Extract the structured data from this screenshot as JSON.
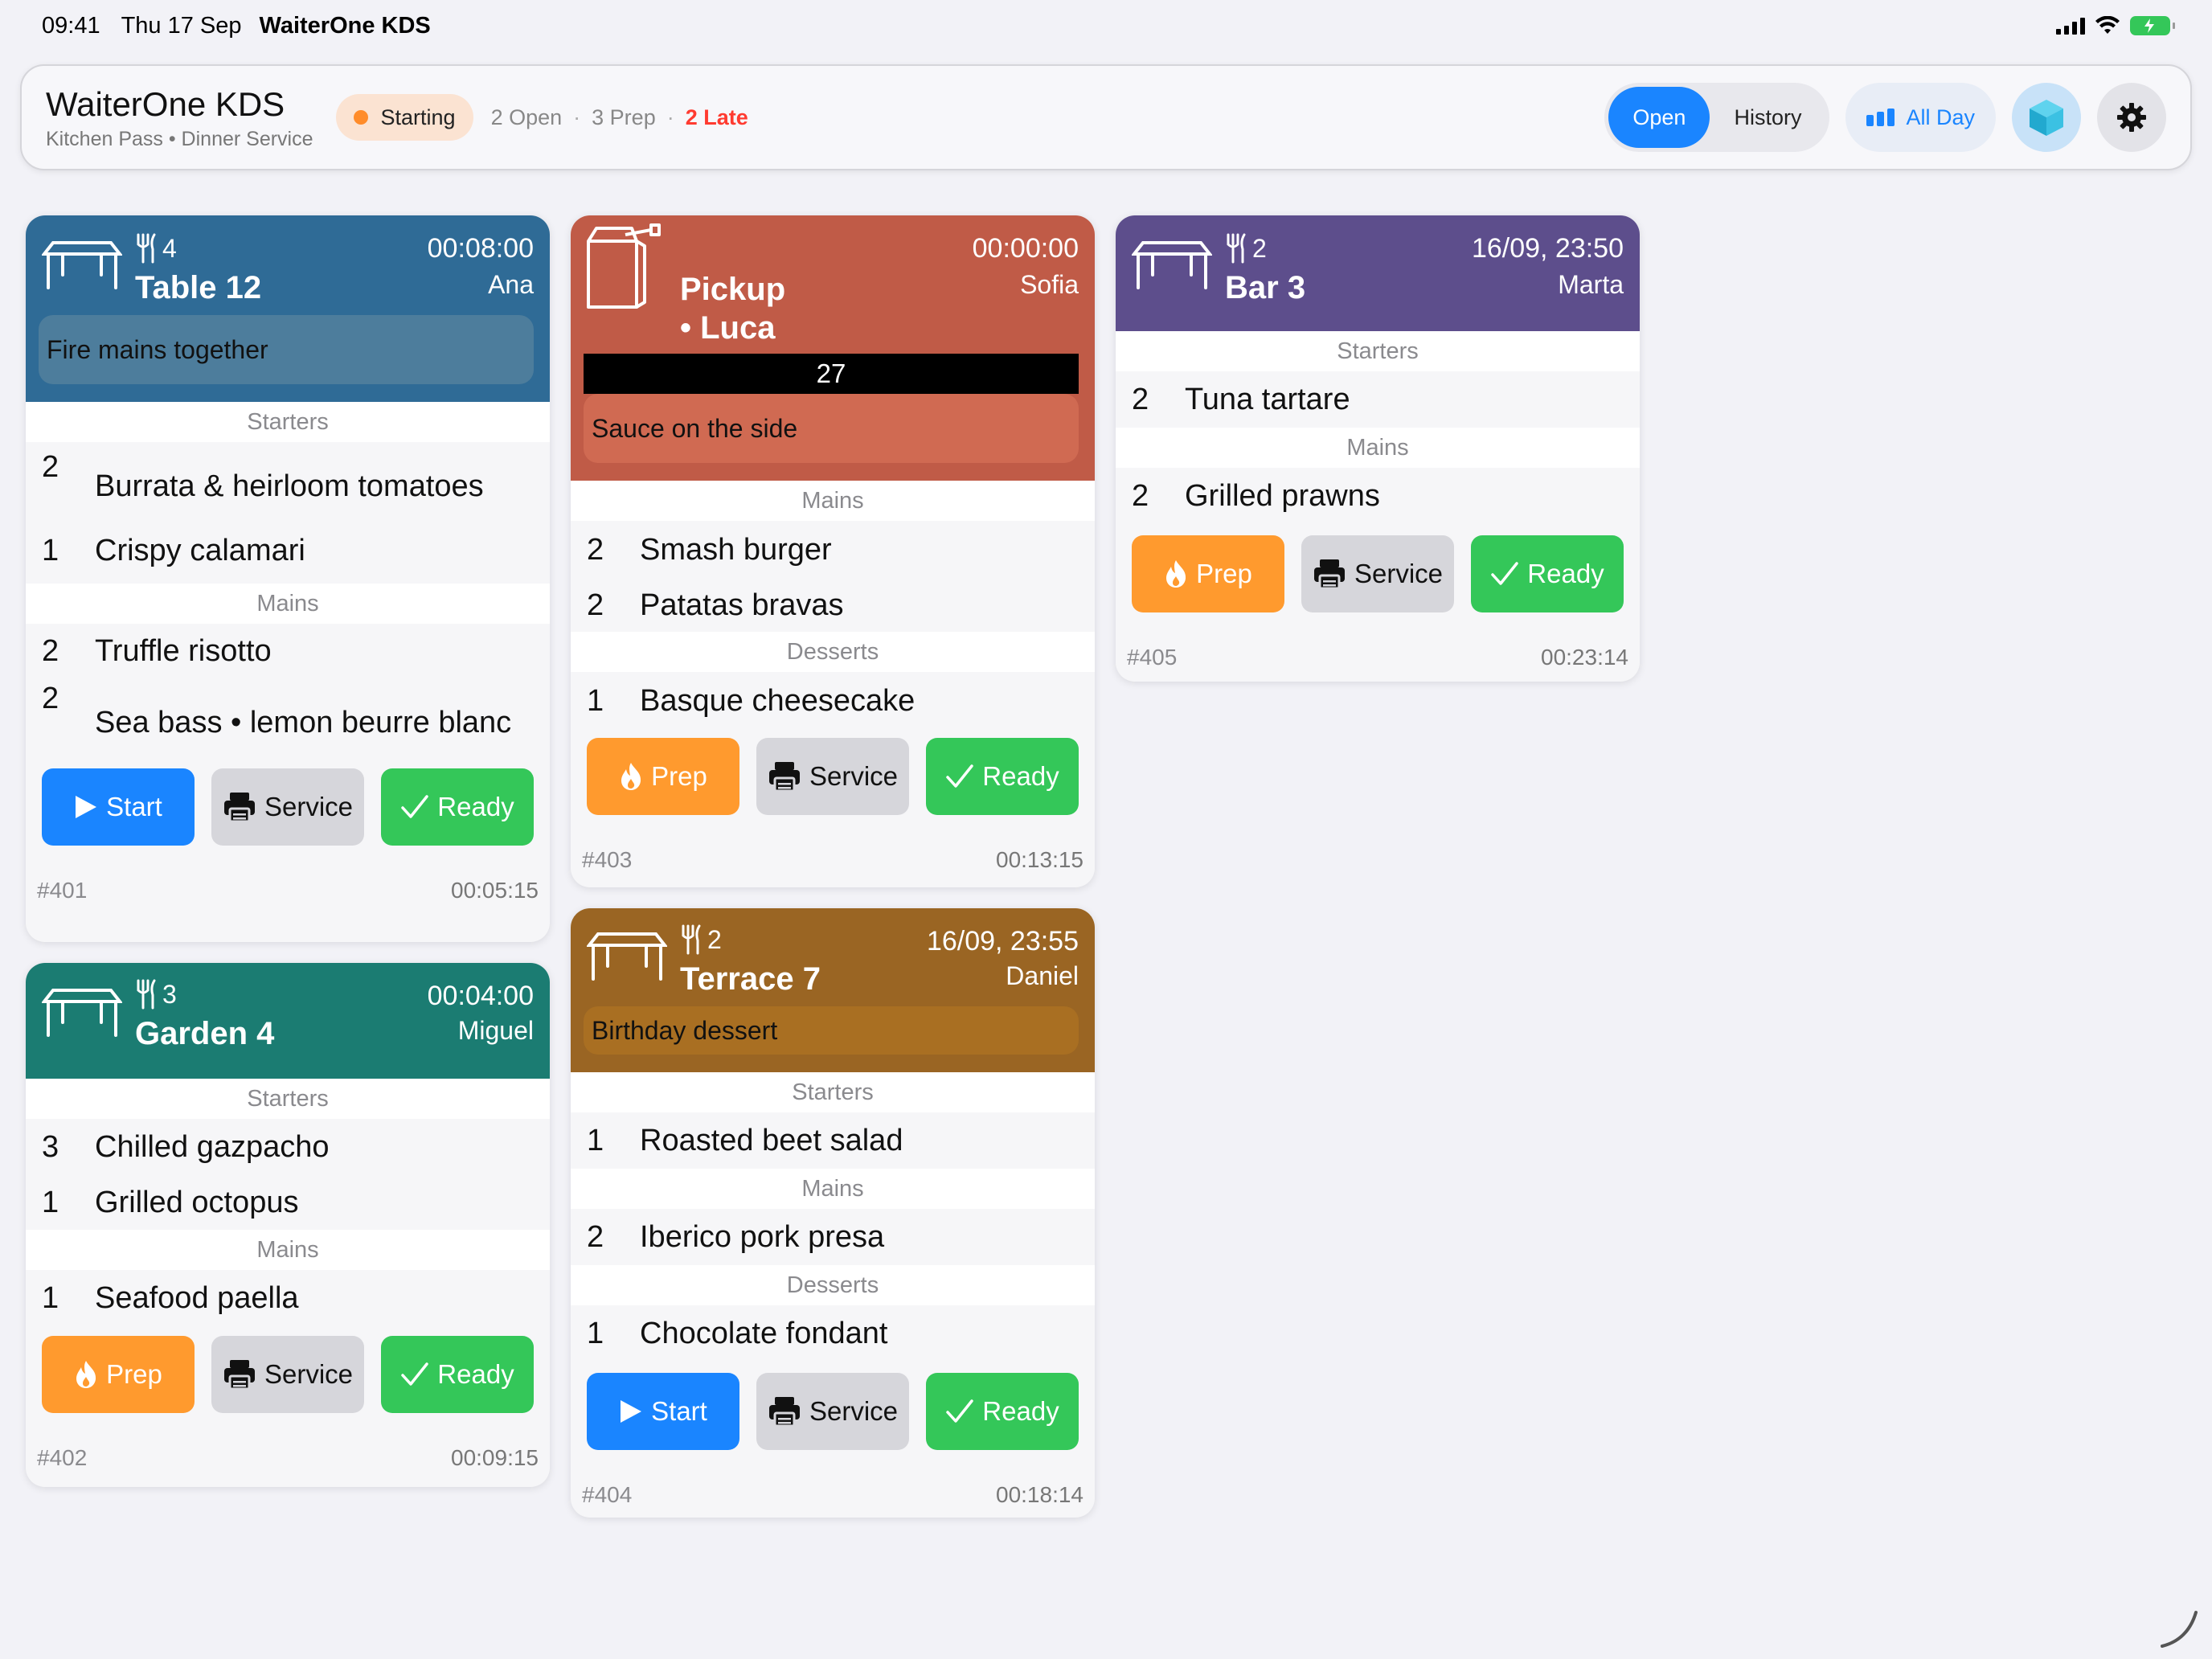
{
  "status_bar": {
    "time": "09:41",
    "date": "Thu 17 Sep",
    "app": "WaiterOne KDS"
  },
  "header": {
    "title": "WaiterOne KDS",
    "subtitle": "Kitchen Pass • Dinner Service",
    "status": "Starting",
    "open_count": "2 Open",
    "prep_count": "3 Prep",
    "late_count": "2 Late",
    "sep": "·",
    "tab_open": "Open",
    "tab_history": "History",
    "all_day": "All Day",
    "colors": {
      "accent": "#1a85ff",
      "late": "#ff3b30",
      "status_dot": "#ff8c2a"
    }
  },
  "tickets": [
    {
      "name": "Table 12",
      "covers": "4",
      "timer": "00:08:00",
      "server": "Ana",
      "note": "Fire mains together",
      "color": "#2f6b96",
      "note_color": "#4d7d9c",
      "sections": [
        {
          "label": "Starters",
          "items": [
            {
              "qty": "2",
              "name": "Burrata & heirloom tomatoes"
            },
            {
              "qty": "1",
              "name": "Crispy calamari"
            }
          ]
        },
        {
          "label": "Mains",
          "items": [
            {
              "qty": "2",
              "name": "Truffle risotto"
            },
            {
              "qty": "2",
              "name": "Sea bass • lemon beurre blanc"
            }
          ]
        }
      ],
      "primary": "Start",
      "service": "Service",
      "ready": "Ready",
      "number": "#401",
      "elapsed": "00:05:15"
    },
    {
      "name": "Garden 4",
      "covers": "3",
      "timer": "00:04:00",
      "server": "Miguel",
      "color": "#1b7c72",
      "sections": [
        {
          "label": "Starters",
          "items": [
            {
              "qty": "3",
              "name": "Chilled gazpacho"
            },
            {
              "qty": "1",
              "name": "Grilled octopus"
            }
          ]
        },
        {
          "label": "Mains",
          "items": [
            {
              "qty": "1",
              "name": "Seafood paella"
            }
          ]
        }
      ],
      "primary": "Prep",
      "service": "Service",
      "ready": "Ready",
      "number": "#402",
      "elapsed": "00:09:15"
    },
    {
      "name": "Pickup",
      "name2": "• Luca",
      "timer": "00:00:00",
      "server": "Sofia",
      "pickup_number": "27",
      "note": "Sauce on the side",
      "color": "#c05b47",
      "note_color": "#d06a52",
      "sections": [
        {
          "label": "Mains",
          "items": [
            {
              "qty": "2",
              "name": "Smash burger"
            },
            {
              "qty": "2",
              "name": "Patatas bravas"
            }
          ]
        },
        {
          "label": "Desserts",
          "items": [
            {
              "qty": "1",
              "name": "Basque cheesecake"
            }
          ]
        }
      ],
      "primary": "Prep",
      "service": "Service",
      "ready": "Ready",
      "number": "#403",
      "elapsed": "00:13:15"
    },
    {
      "name": "Terrace 7",
      "covers": "2",
      "timer": "16/09, 23:55",
      "server": "Daniel",
      "note": "Birthday dessert",
      "color": "#9a6523",
      "note_color": "#a96f22",
      "sections": [
        {
          "label": "Starters",
          "items": [
            {
              "qty": "1",
              "name": "Roasted beet salad"
            }
          ]
        },
        {
          "label": "Mains",
          "items": [
            {
              "qty": "2",
              "name": "Iberico pork presa"
            }
          ]
        },
        {
          "label": "Desserts",
          "items": [
            {
              "qty": "1",
              "name": "Chocolate fondant"
            }
          ]
        }
      ],
      "primary": "Start",
      "service": "Service",
      "ready": "Ready",
      "number": "#404",
      "elapsed": "00:18:14"
    },
    {
      "name": "Bar 3",
      "covers": "2",
      "timer": "16/09, 23:50",
      "server": "Marta",
      "color": "#5d4e8c",
      "sections": [
        {
          "label": "Starters",
          "items": [
            {
              "qty": "2",
              "name": "Tuna tartare"
            }
          ]
        },
        {
          "label": "Mains",
          "items": [
            {
              "qty": "2",
              "name": "Grilled prawns"
            }
          ]
        }
      ],
      "primary": "Prep",
      "service": "Service",
      "ready": "Ready",
      "number": "#405",
      "elapsed": "00:23:14"
    }
  ]
}
